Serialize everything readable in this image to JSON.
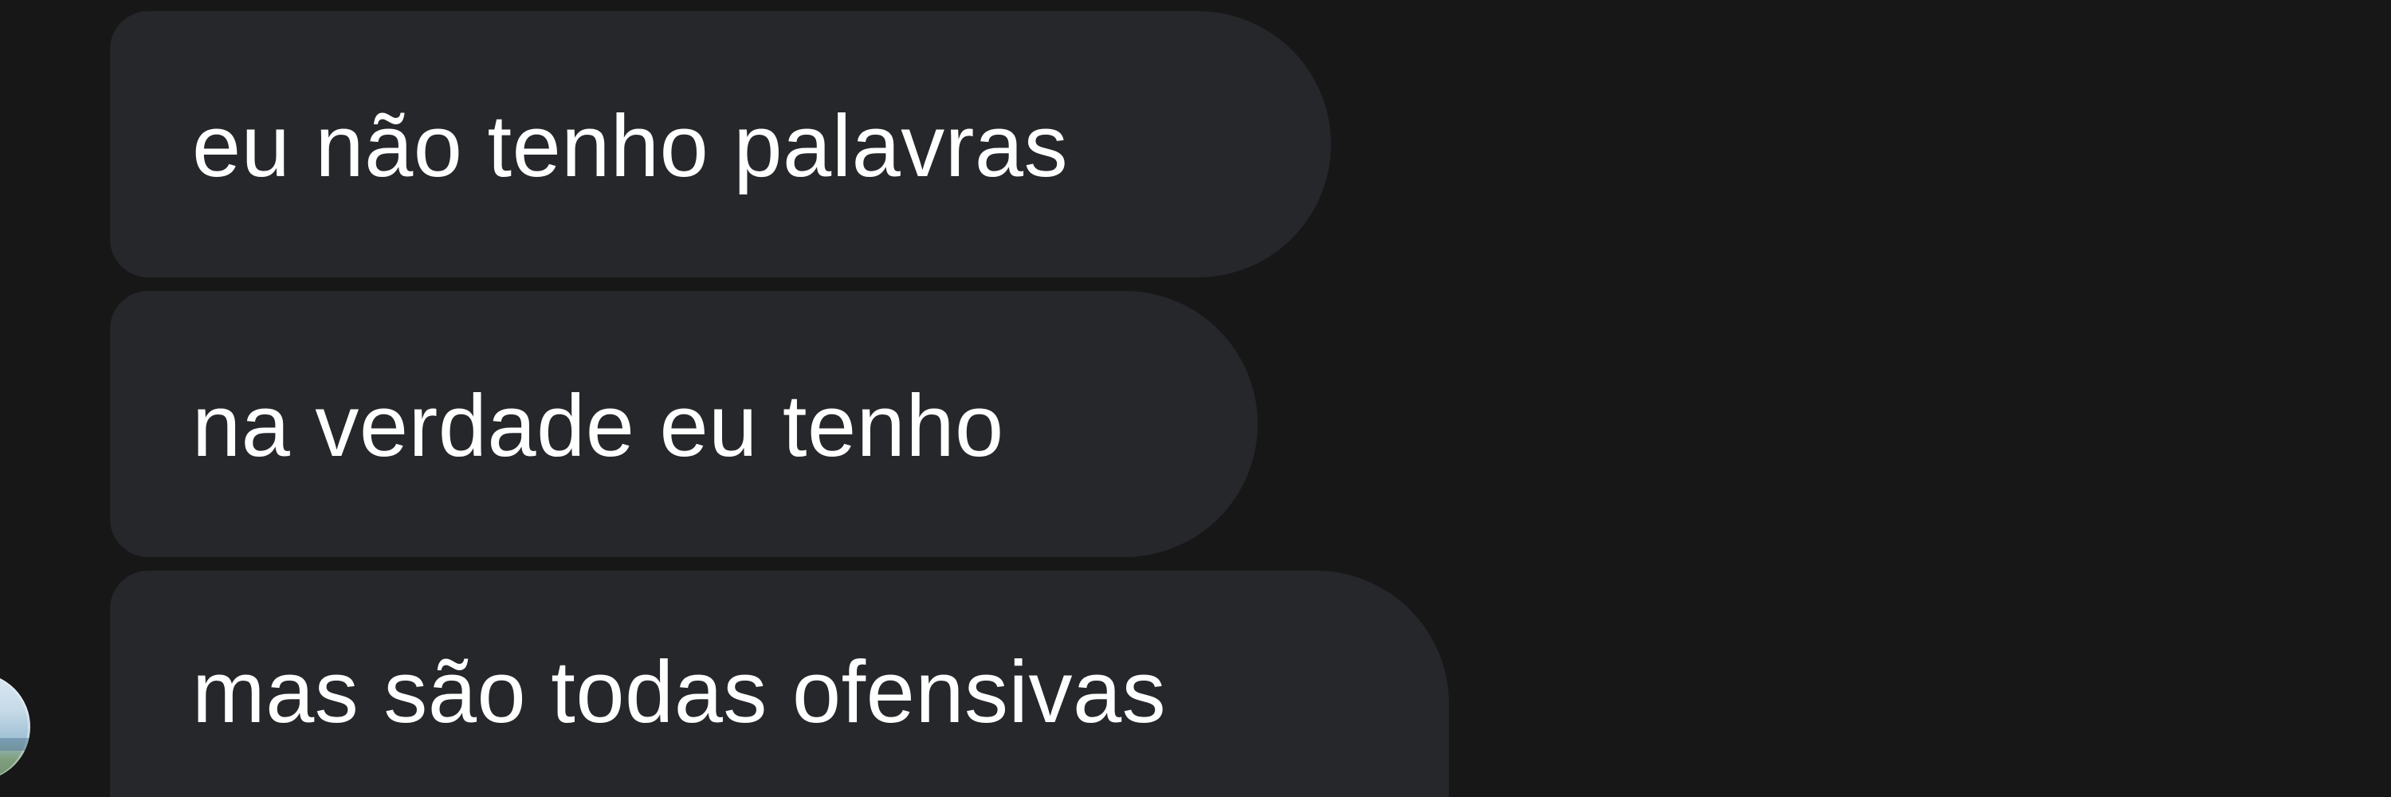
{
  "conversation": {
    "messages": [
      {
        "text": "eu não tenho palavras"
      },
      {
        "text": "na verdade eu tenho"
      },
      {
        "text": "mas são todas ofensivas"
      }
    ],
    "sender_avatar": "avatar-icon"
  },
  "colors": {
    "background": "#171717",
    "bubble": "#25272b",
    "text": "#ffffff"
  }
}
